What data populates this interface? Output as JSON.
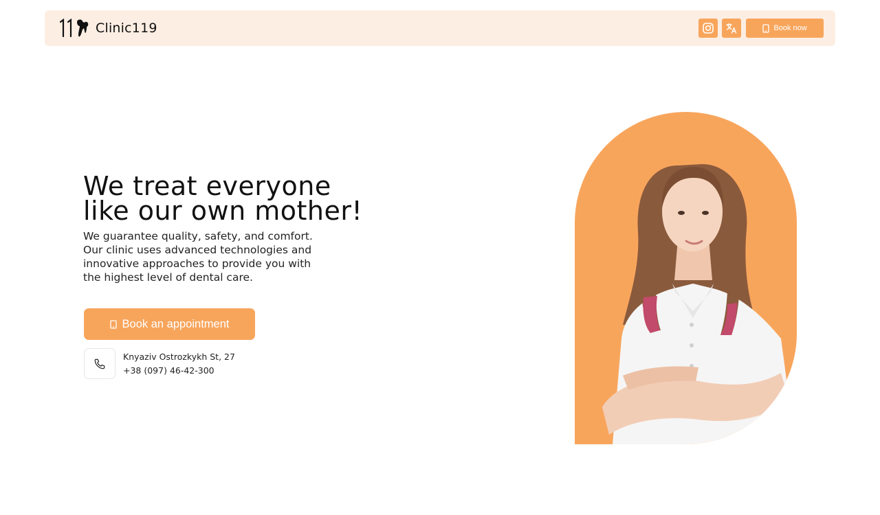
{
  "header": {
    "brand": "Clinic119",
    "book_label": "Book now",
    "icons": {
      "instagram": "instagram-icon",
      "translate": "translate-icon",
      "tablet": "tablet-icon"
    }
  },
  "hero": {
    "title": "We treat everyone like our own mother!",
    "description": "We guarantee quality, safety, and comfort. Our clinic uses advanced technologies and innovative approaches to provide you with the highest level of dental care.",
    "cta_label": "Book an appointment"
  },
  "contact": {
    "address": "Knyaziv Ostrozkykh St, 27",
    "phone": "+38 (097) 46-42-300"
  },
  "colors": {
    "accent": "#f8a55c",
    "header_bg": "#fdeee3"
  }
}
